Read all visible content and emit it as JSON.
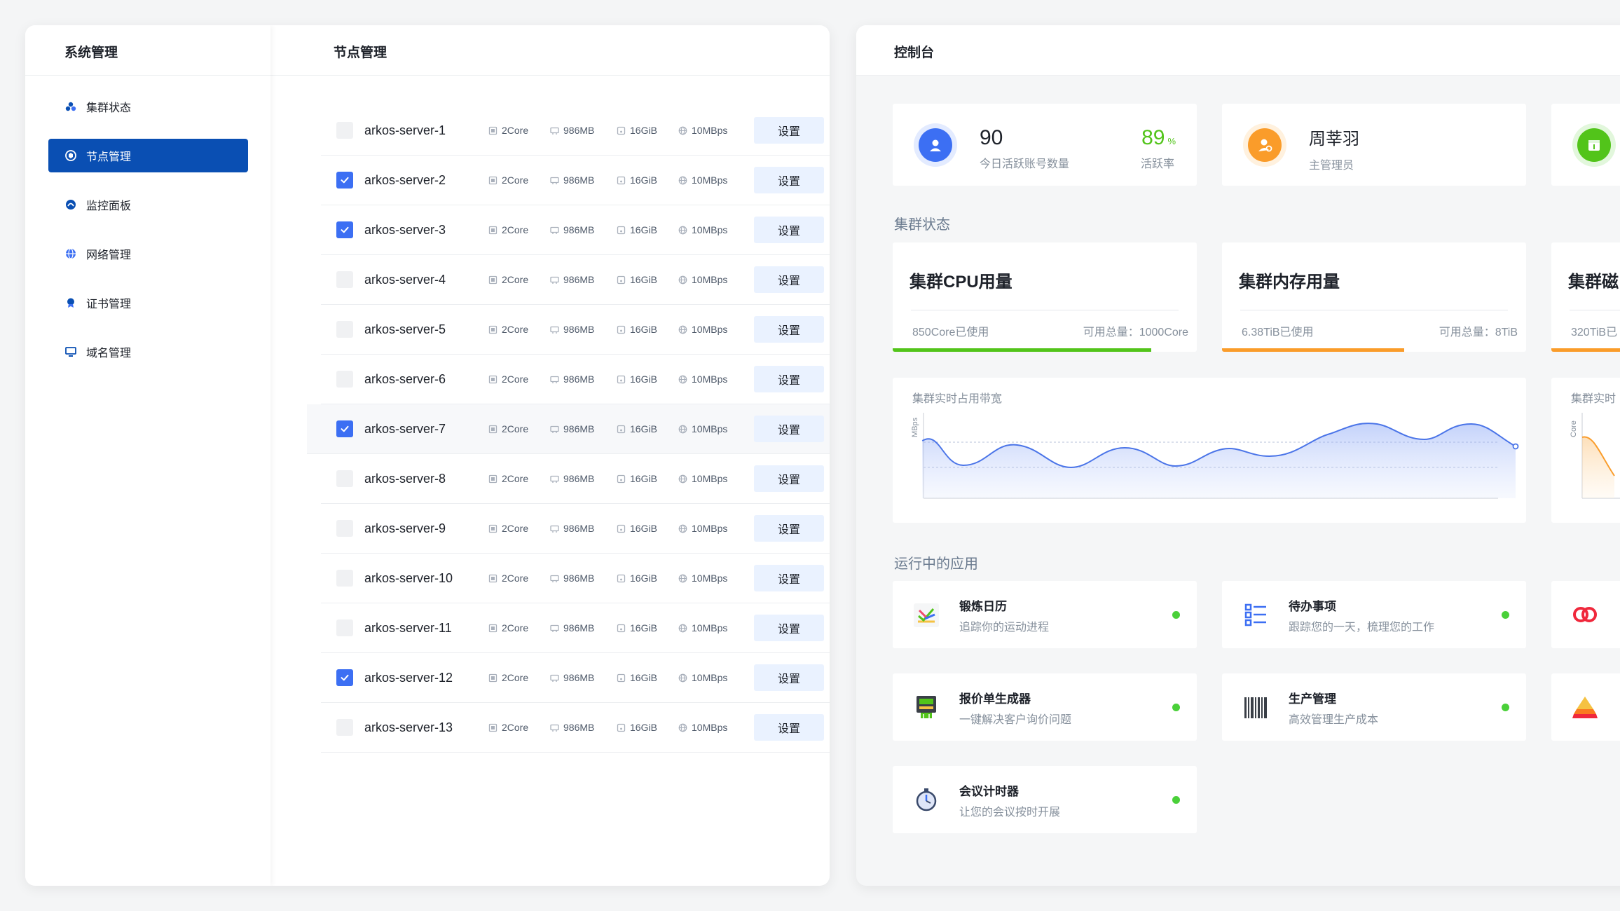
{
  "system": {
    "title": "系统管理",
    "nav": [
      {
        "label": "集群状态",
        "icon": "cluster-icon"
      },
      {
        "label": "节点管理",
        "icon": "node-icon",
        "active": true
      },
      {
        "label": "监控面板",
        "icon": "monitor-icon"
      },
      {
        "label": "网络管理",
        "icon": "globe-icon"
      },
      {
        "label": "证书管理",
        "icon": "certificate-icon"
      },
      {
        "label": "域名管理",
        "icon": "desktop-icon"
      }
    ]
  },
  "nodes": {
    "title": "节点管理",
    "settings_label": "设置",
    "items": [
      {
        "name": "arkos-server-1",
        "cpu": "2Core",
        "mem": "986MB",
        "disk": "16GiB",
        "net": "10MBps",
        "checked": false
      },
      {
        "name": "arkos-server-2",
        "cpu": "2Core",
        "mem": "986MB",
        "disk": "16GiB",
        "net": "10MBps",
        "checked": true
      },
      {
        "name": "arkos-server-3",
        "cpu": "2Core",
        "mem": "986MB",
        "disk": "16GiB",
        "net": "10MBps",
        "checked": true
      },
      {
        "name": "arkos-server-4",
        "cpu": "2Core",
        "mem": "986MB",
        "disk": "16GiB",
        "net": "10MBps",
        "checked": false
      },
      {
        "name": "arkos-server-5",
        "cpu": "2Core",
        "mem": "986MB",
        "disk": "16GiB",
        "net": "10MBps",
        "checked": false
      },
      {
        "name": "arkos-server-6",
        "cpu": "2Core",
        "mem": "986MB",
        "disk": "16GiB",
        "net": "10MBps",
        "checked": false
      },
      {
        "name": "arkos-server-7",
        "cpu": "2Core",
        "mem": "986MB",
        "disk": "16GiB",
        "net": "10MBps",
        "checked": true,
        "highlight": true
      },
      {
        "name": "arkos-server-8",
        "cpu": "2Core",
        "mem": "986MB",
        "disk": "16GiB",
        "net": "10MBps",
        "checked": false
      },
      {
        "name": "arkos-server-9",
        "cpu": "2Core",
        "mem": "986MB",
        "disk": "16GiB",
        "net": "10MBps",
        "checked": false
      },
      {
        "name": "arkos-server-10",
        "cpu": "2Core",
        "mem": "986MB",
        "disk": "16GiB",
        "net": "10MBps",
        "checked": false
      },
      {
        "name": "arkos-server-11",
        "cpu": "2Core",
        "mem": "986MB",
        "disk": "16GiB",
        "net": "10MBps",
        "checked": false
      },
      {
        "name": "arkos-server-12",
        "cpu": "2Core",
        "mem": "986MB",
        "disk": "16GiB",
        "net": "10MBps",
        "checked": true
      },
      {
        "name": "arkos-server-13",
        "cpu": "2Core",
        "mem": "986MB",
        "disk": "16GiB",
        "net": "10MBps",
        "checked": false
      }
    ]
  },
  "console": {
    "title": "控制台",
    "active_accounts": {
      "value": "90",
      "label": "今日活跃账号数量",
      "rate": "89",
      "rate_unit": "%",
      "rate_label": "活跃率"
    },
    "user": {
      "name": "周莘羽",
      "role": "主管理员"
    },
    "cluster_section": "集群状态",
    "cpu": {
      "title": "集群CPU用量",
      "used": "850Core已使用",
      "total": "可用总量：1000Core",
      "ratio": 0.85,
      "color": "#52c41a"
    },
    "memory": {
      "title": "集群内存用量",
      "used": "6.38TiB已使用",
      "total": "可用总量：8TiB",
      "ratio": 0.6,
      "color": "#fa9c2a"
    },
    "disk": {
      "title": "集群磁",
      "used": "320TiB已",
      "color": "#fa9c2a"
    },
    "bandwidth_chart": {
      "title": "集群实时占用带宽",
      "unit": "MBps"
    },
    "cpu_chart": {
      "title": "集群实时",
      "unit": "Core"
    },
    "apps_section": "运行中的应用",
    "apps": [
      {
        "name": "锻炼日历",
        "desc": "追踪你的运动进程",
        "icon": "exercise-icon"
      },
      {
        "name": "待办事项",
        "desc": "跟踪您的一天，梳理您的工作",
        "icon": "todo-list-icon"
      },
      {
        "name": "报价单生成器",
        "desc": "一键解决客户询价问题",
        "icon": "quote-generator-icon"
      },
      {
        "name": "生产管理",
        "desc": "高效管理生产成本",
        "icon": "barcode-icon"
      },
      {
        "name": "会议计时器",
        "desc": "让您的会议按时开展",
        "icon": "stopwatch-icon"
      }
    ]
  }
}
